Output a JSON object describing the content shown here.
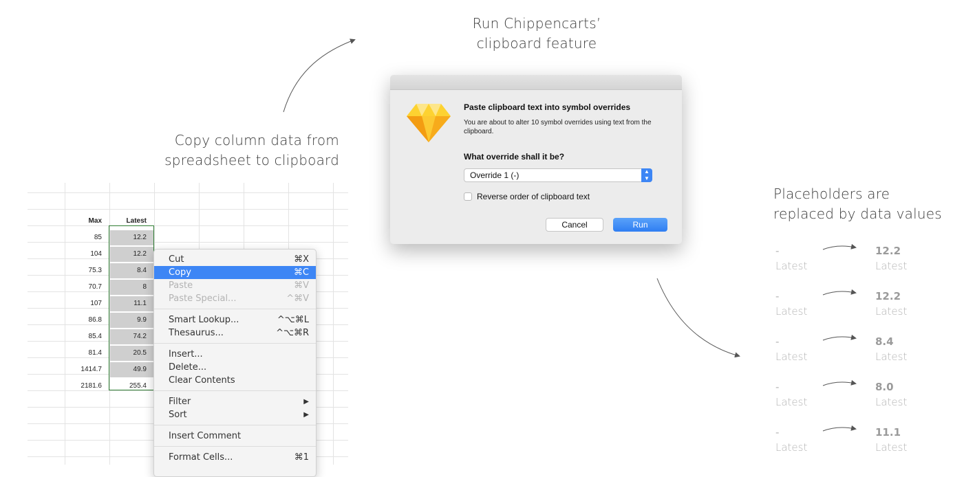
{
  "captions": {
    "run": [
      "Run Chippencarts’",
      "clipboard feature"
    ],
    "copy": [
      "Copy column data from",
      "spreadsheet to clipboard"
    ],
    "placeholders": [
      "Placeholders are",
      "replaced by data values"
    ]
  },
  "spreadsheet": {
    "headers": {
      "max": "Max",
      "latest": "Latest"
    },
    "rows": [
      {
        "max": "85",
        "latest": "12.2"
      },
      {
        "max": "104",
        "latest": "12.2"
      },
      {
        "max": "75.3",
        "latest": "8.4"
      },
      {
        "max": "70.7",
        "latest": "8"
      },
      {
        "max": "107",
        "latest": "11.1"
      },
      {
        "max": "86.8",
        "latest": "9.9"
      },
      {
        "max": "85.4",
        "latest": "74.2"
      },
      {
        "max": "81.4",
        "latest": "20.5"
      },
      {
        "max": "1414.7",
        "latest": "49.9"
      },
      {
        "max": "2181.6",
        "latest": "255.4"
      }
    ]
  },
  "context_menu": {
    "items": [
      {
        "label": "Cut",
        "shortcut": "⌘X"
      },
      {
        "label": "Copy",
        "shortcut": "⌘C"
      },
      {
        "label": "Paste",
        "shortcut": "⌘V"
      },
      {
        "label": "Paste Special...",
        "shortcut": "^⌘V"
      },
      {
        "label": "Smart Lookup...",
        "shortcut": "^⌥⌘L"
      },
      {
        "label": "Thesaurus...",
        "shortcut": "^⌥⌘R"
      },
      {
        "label": "Insert...",
        "shortcut": ""
      },
      {
        "label": "Delete...",
        "shortcut": ""
      },
      {
        "label": "Clear Contents",
        "shortcut": ""
      },
      {
        "label": "Filter",
        "shortcut": "▶"
      },
      {
        "label": "Sort",
        "shortcut": "▶"
      },
      {
        "label": "Insert Comment",
        "shortcut": ""
      },
      {
        "label": "Format Cells...",
        "shortcut": "⌘1"
      }
    ],
    "highlighted_item": "Copy",
    "disabled_items": [
      "Paste",
      "Paste Special..."
    ]
  },
  "dialog": {
    "icon": "sketch-diamond-icon",
    "title": "Paste clipboard text into symbol overrides",
    "description": "You are about to alter 10 symbol overrides using text from the clipboard.",
    "question": "What override shall it be?",
    "select_value": "Override 1 (-)",
    "checkbox_label": "Reverse order of clipboard text",
    "checkbox_checked": false,
    "cancel_label": "Cancel",
    "run_label": "Run"
  },
  "placeholders": [
    {
      "before": "-",
      "after": "12.2",
      "label": "Latest"
    },
    {
      "before": "-",
      "after": "12.2",
      "label": "Latest"
    },
    {
      "before": "-",
      "after": "8.4",
      "label": "Latest"
    },
    {
      "before": "-",
      "after": "8.0",
      "label": "Latest"
    },
    {
      "before": "-",
      "after": "11.1",
      "label": "Latest"
    }
  ],
  "colors": {
    "accent": "#3d86f5",
    "selection_border": "#2e7d32",
    "selection_fill": "#cfcfcf",
    "gem_top": "#fdd231",
    "gem_body": "#f7ab1b"
  }
}
